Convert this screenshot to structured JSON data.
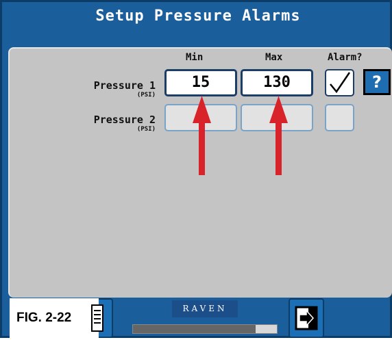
{
  "window": {
    "title": "Setup Pressure Alarms"
  },
  "columns": {
    "min": "Min",
    "max": "Max",
    "alarm": "Alarm?"
  },
  "rows": [
    {
      "label": "Pressure 1",
      "unit": "(PSI)",
      "min": "15",
      "max": "130",
      "alarm_checked": true
    },
    {
      "label": "Pressure 2",
      "unit": "(PSI)",
      "min": "",
      "max": "",
      "alarm_checked": false
    }
  ],
  "help": {
    "label": "?"
  },
  "branding": {
    "logo_text": "RAVEN"
  },
  "progress": {
    "fraction": 0.85
  },
  "figure": {
    "caption": "FIG. 2-22"
  },
  "colors": {
    "accent": "#1a5f9b",
    "arrow": "#d9232a",
    "panel": "#c4c4c4"
  },
  "icons": {
    "back": "document-icon",
    "next": "exit-arrow-icon"
  }
}
